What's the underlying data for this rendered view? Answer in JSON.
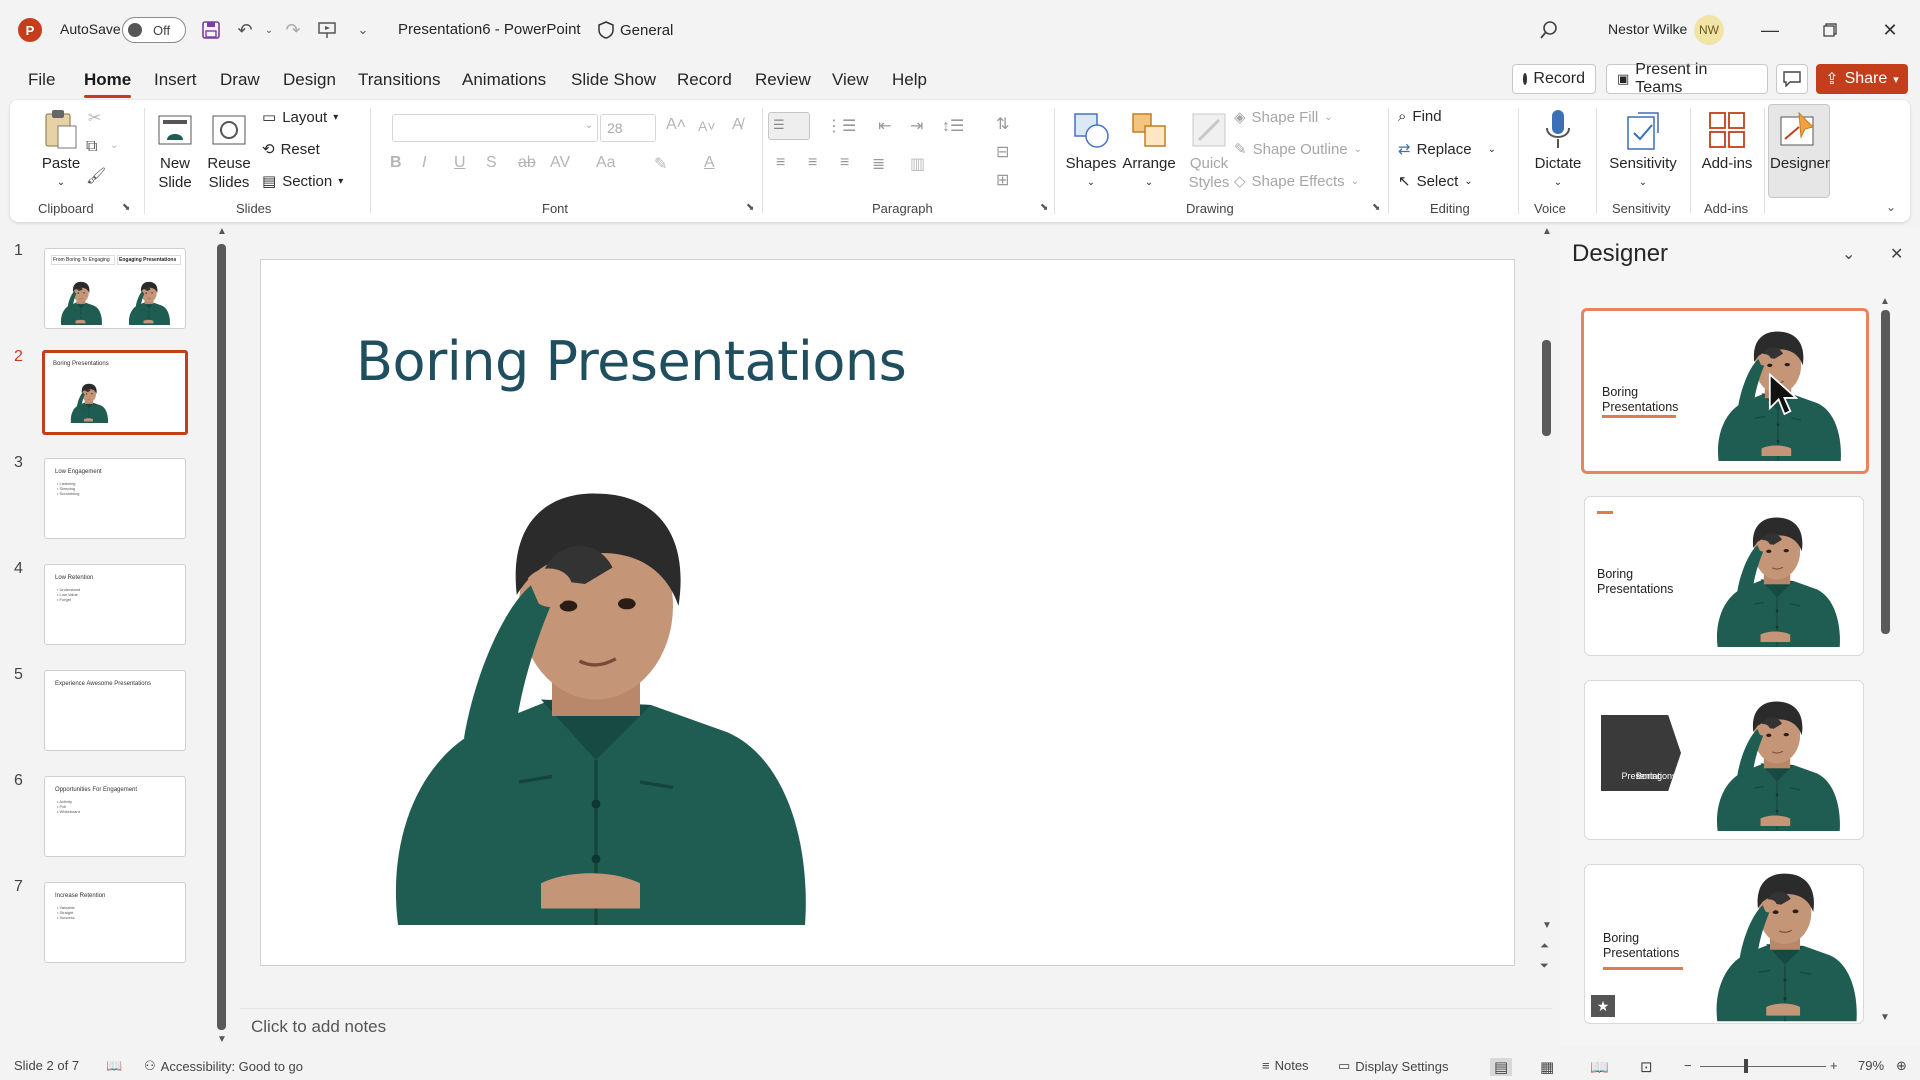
{
  "titlebar": {
    "app_initial": "P",
    "autosave_label": "AutoSave",
    "autosave_state": "Off",
    "document": "Presentation6  -  PowerPoint",
    "sensitivity": "General",
    "user_name": "Nestor Wilke",
    "user_initials": "NW"
  },
  "tabs": [
    "File",
    "Home",
    "Insert",
    "Draw",
    "Design",
    "Transitions",
    "Animations",
    "Slide Show",
    "Record",
    "Review",
    "View",
    "Help"
  ],
  "tab_buttons": {
    "record": "Record",
    "present": "Present in Teams",
    "share": "Share"
  },
  "ribbon": {
    "clipboard": {
      "paste": "Paste",
      "label": "Clipboard"
    },
    "slides": {
      "new_slide_1": "New",
      "new_slide_2": "Slide",
      "reuse_1": "Reuse",
      "reuse_2": "Slides",
      "layout": "Layout",
      "reset": "Reset",
      "section": "Section",
      "label": "Slides"
    },
    "font": {
      "size": "28",
      "label": "Font"
    },
    "paragraph": {
      "label": "Paragraph"
    },
    "drawing": {
      "shapes": "Shapes",
      "arrange": "Arrange",
      "quick_styles_1": "Quick",
      "quick_styles_2": "Styles",
      "shape_fill": "Shape Fill",
      "shape_outline": "Shape Outline",
      "shape_effects": "Shape Effects",
      "label": "Drawing"
    },
    "editing": {
      "find": "Find",
      "replace": "Replace",
      "select": "Select",
      "label": "Editing"
    },
    "voice": {
      "dictate": "Dictate",
      "label": "Voice"
    },
    "sensitivity": {
      "button": "Sensitivity",
      "label": "Sensitivity"
    },
    "addins": {
      "button": "Add-ins",
      "label": "Add-ins"
    },
    "designer": {
      "button": "Designer"
    }
  },
  "thumbnails": [
    {
      "num": "1",
      "title": "From Boring To Engaging",
      "subtitle": "Engaging Presentations",
      "bullets": []
    },
    {
      "num": "2",
      "title": "Boring Presentations",
      "bullets": []
    },
    {
      "num": "3",
      "title": "Low Engagement",
      "bullets": [
        "• Listening",
        "• Sleeping",
        "• Scrambling"
      ]
    },
    {
      "num": "4",
      "title": "Low Retention",
      "bullets": [
        "• Understand",
        "• Low Value",
        "• Forget"
      ]
    },
    {
      "num": "5",
      "title": "Experience Awesome Presentations",
      "bullets": []
    },
    {
      "num": "6",
      "title": "Opportunities For Engagement",
      "bullets": [
        "• Activity",
        "• Poll",
        "• Whiteboard"
      ]
    },
    {
      "num": "7",
      "title": "Increase Retention",
      "bullets": [
        "• Valuable",
        "• Straight",
        "• Success"
      ]
    }
  ],
  "slide": {
    "title": "Boring Presentations"
  },
  "notes_placeholder": "Click to add notes",
  "designer": {
    "title": "Designer",
    "ideas": [
      {
        "text_1": "Boring",
        "text_2": "Presentations"
      },
      {
        "text_1": "Boring",
        "text_2": "Presentations"
      },
      {
        "text_1": "Boring",
        "text_2": "Presentations"
      },
      {
        "text_1": "Boring",
        "text_2": "Presentations"
      }
    ]
  },
  "status": {
    "slide_pos": "Slide 2 of 7",
    "accessibility": "Accessibility: Good to go",
    "notes": "Notes",
    "display": "Display Settings",
    "zoom": "79%"
  },
  "colors": {
    "accent": "#c43e1c",
    "title": "#1f4e5f",
    "shirt": "#1f5c52"
  }
}
